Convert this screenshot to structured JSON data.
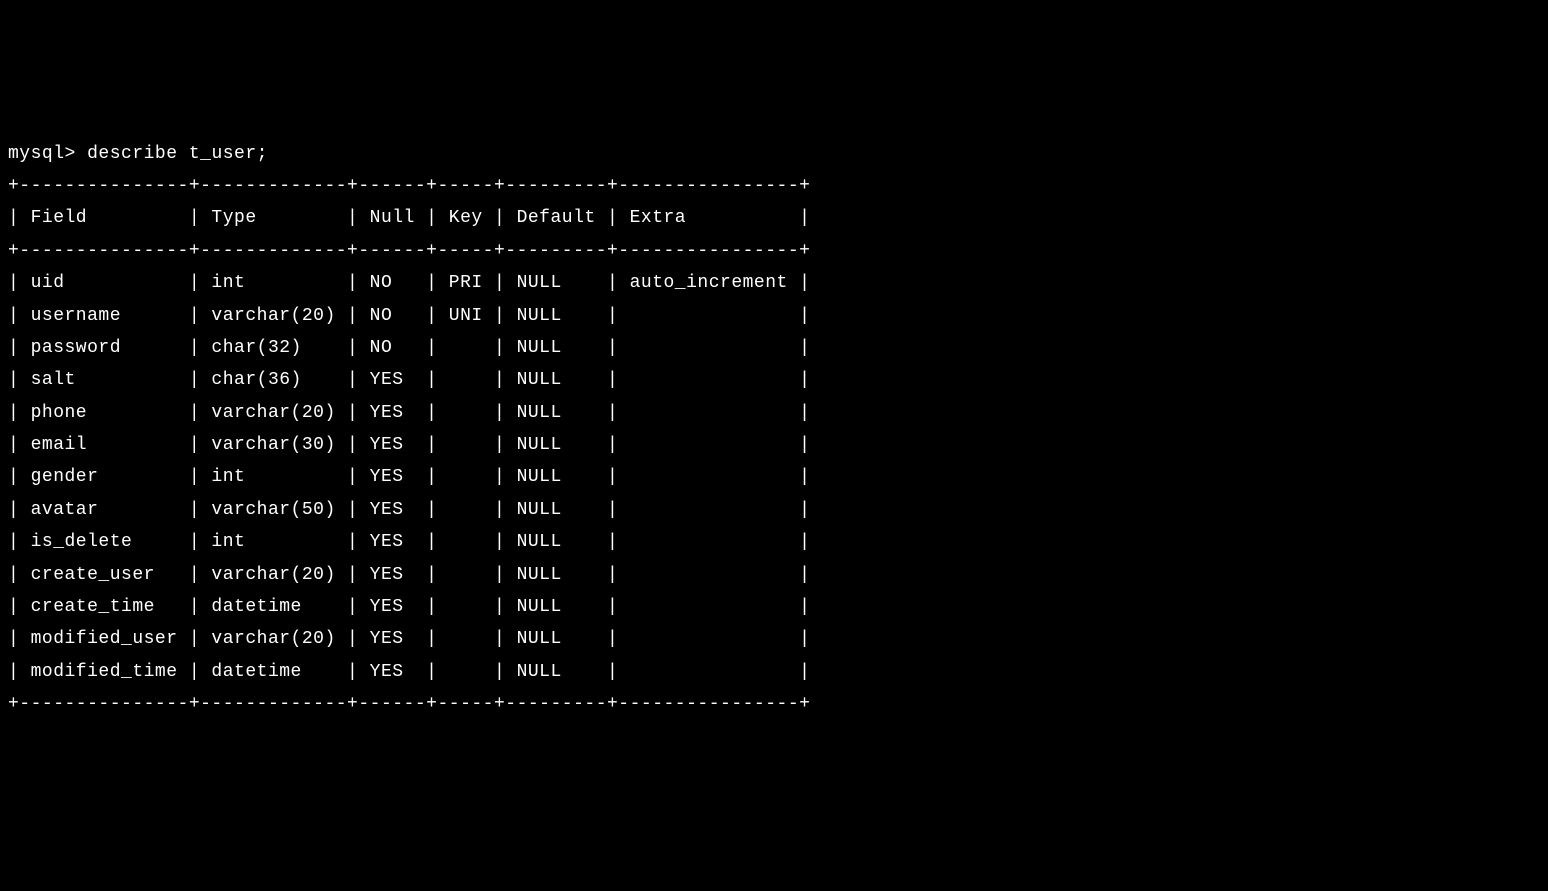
{
  "prompt": "mysql> ",
  "command": "describe t_user;",
  "chart_data": {
    "type": "table",
    "headers": [
      "Field",
      "Type",
      "Null",
      "Key",
      "Default",
      "Extra"
    ],
    "rows": [
      {
        "field": "uid",
        "type": "int",
        "null": "NO",
        "key": "PRI",
        "default": "NULL",
        "extra": "auto_increment"
      },
      {
        "field": "username",
        "type": "varchar(20)",
        "null": "NO",
        "key": "UNI",
        "default": "NULL",
        "extra": ""
      },
      {
        "field": "password",
        "type": "char(32)",
        "null": "NO",
        "key": "",
        "default": "NULL",
        "extra": ""
      },
      {
        "field": "salt",
        "type": "char(36)",
        "null": "YES",
        "key": "",
        "default": "NULL",
        "extra": ""
      },
      {
        "field": "phone",
        "type": "varchar(20)",
        "null": "YES",
        "key": "",
        "default": "NULL",
        "extra": ""
      },
      {
        "field": "email",
        "type": "varchar(30)",
        "null": "YES",
        "key": "",
        "default": "NULL",
        "extra": ""
      },
      {
        "field": "gender",
        "type": "int",
        "null": "YES",
        "key": "",
        "default": "NULL",
        "extra": ""
      },
      {
        "field": "avatar",
        "type": "varchar(50)",
        "null": "YES",
        "key": "",
        "default": "NULL",
        "extra": ""
      },
      {
        "field": "is_delete",
        "type": "int",
        "null": "YES",
        "key": "",
        "default": "NULL",
        "extra": ""
      },
      {
        "field": "create_user",
        "type": "varchar(20)",
        "null": "YES",
        "key": "",
        "default": "NULL",
        "extra": ""
      },
      {
        "field": "create_time",
        "type": "datetime",
        "null": "YES",
        "key": "",
        "default": "NULL",
        "extra": ""
      },
      {
        "field": "modified_user",
        "type": "varchar(20)",
        "null": "YES",
        "key": "",
        "default": "NULL",
        "extra": ""
      },
      {
        "field": "modified_time",
        "type": "datetime",
        "null": "YES",
        "key": "",
        "default": "NULL",
        "extra": ""
      }
    ]
  },
  "col_widths": {
    "field": 13,
    "type": 11,
    "null": 4,
    "key": 3,
    "default": 7,
    "extra": 14
  }
}
